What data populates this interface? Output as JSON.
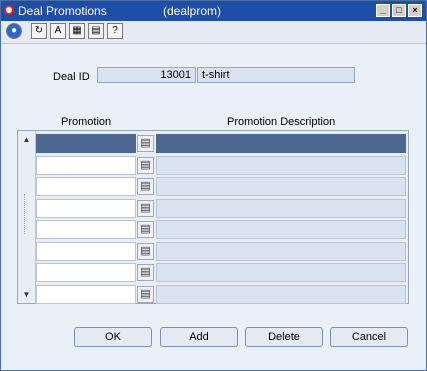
{
  "window": {
    "title": "Deal Promotions",
    "form_name": "(dealprom)",
    "controls": [
      "minimize-icon",
      "maximize-icon",
      "close-icon"
    ]
  },
  "toolbar": {
    "icons": [
      "globe-icon",
      "refresh-icon",
      "spell-icon",
      "calendar-icon",
      "print-icon",
      "help-icon"
    ]
  },
  "deal": {
    "label": "Deal ID",
    "id": "13001",
    "description": "t-shirt"
  },
  "grid": {
    "columns": {
      "promotion": "Promotion",
      "description": "Promotion Description"
    },
    "rows": [
      {
        "promotion": "",
        "description": "",
        "selected": true
      },
      {
        "promotion": "",
        "description": ""
      },
      {
        "promotion": "",
        "description": ""
      },
      {
        "promotion": "",
        "description": ""
      },
      {
        "promotion": "",
        "description": ""
      },
      {
        "promotion": "",
        "description": ""
      },
      {
        "promotion": "",
        "description": ""
      },
      {
        "promotion": "",
        "description": ""
      }
    ]
  },
  "buttons": {
    "ok": "OK",
    "add": "Add",
    "delete": "Delete",
    "cancel": "Cancel"
  },
  "colors": {
    "titlebar": "#1f4ea8",
    "selected_row": "#4d6890",
    "field_bg": "#d8e3ef"
  }
}
